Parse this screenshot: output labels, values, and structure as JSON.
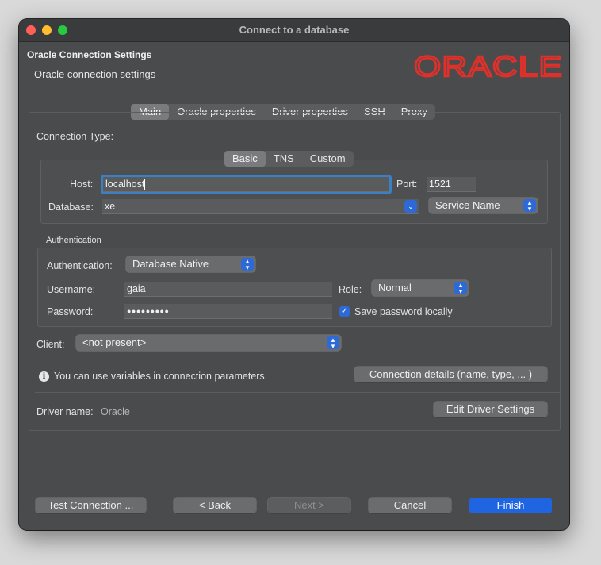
{
  "window": {
    "title": "Connect to a database"
  },
  "header": {
    "title": "Oracle Connection Settings",
    "subtitle": "Oracle connection settings",
    "logo_text": "ORACLE",
    "logo_color": "#e0302a"
  },
  "main_tabs": [
    "Main",
    "Oracle properties",
    "Driver properties",
    "SSH",
    "Proxy"
  ],
  "connection_type": {
    "label": "Connection Type:",
    "tabs": [
      "Basic",
      "TNS",
      "Custom"
    ],
    "host_label": "Host:",
    "host_value": "localhost",
    "port_label": "Port:",
    "port_value": "1521",
    "database_label": "Database:",
    "database_value": "xe",
    "service_value": "Service Name"
  },
  "authentication": {
    "group_label": "Authentication",
    "auth_label": "Authentication:",
    "auth_value": "Database Native",
    "username_label": "Username:",
    "username_value": "gaia",
    "role_label": "Role:",
    "role_value": "Normal",
    "password_label": "Password:",
    "password_value": "●●●●●●●●●",
    "save_password_label": "Save password locally",
    "save_password_checked": true
  },
  "client": {
    "label": "Client:",
    "value": "<not present>"
  },
  "info": {
    "text": "You can use variables in connection parameters.",
    "details_button": "Connection details (name, type, ... )"
  },
  "driver": {
    "label": "Driver name:",
    "value": "Oracle",
    "edit_button": "Edit Driver Settings"
  },
  "footer": {
    "test": "Test Connection ...",
    "back": "< Back",
    "next": "Next >",
    "cancel": "Cancel",
    "finish": "Finish"
  },
  "colors": {
    "accent": "#1f64e0",
    "focus_ring": "#3b7fc4"
  }
}
